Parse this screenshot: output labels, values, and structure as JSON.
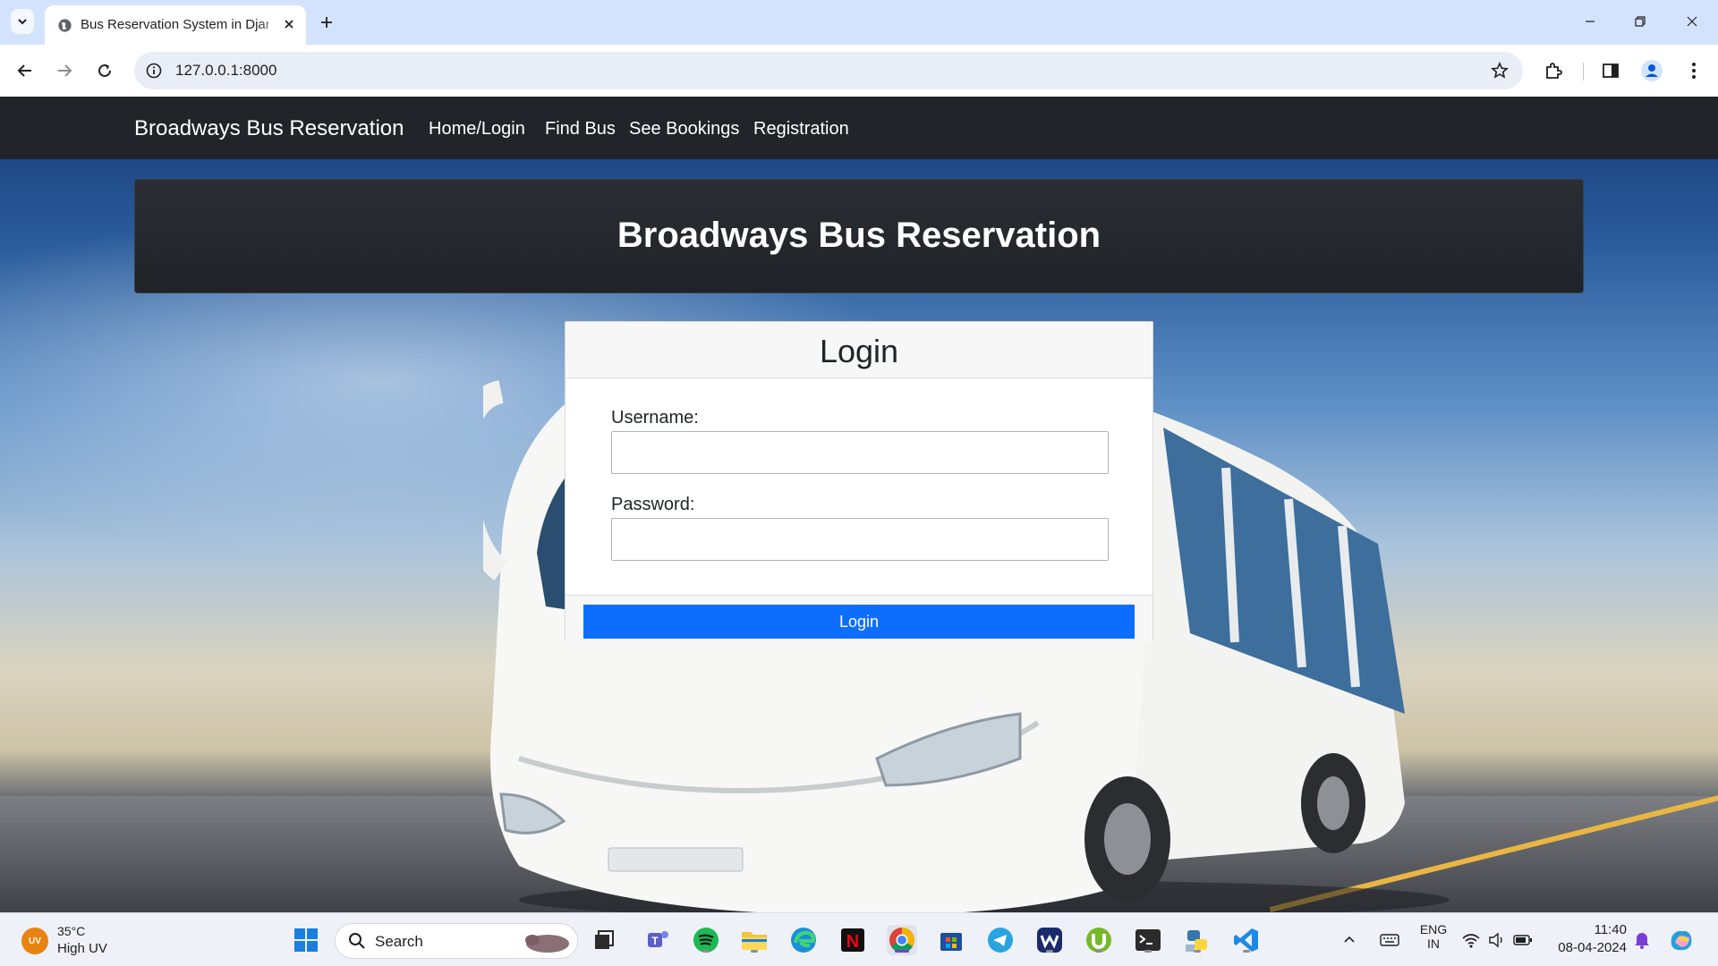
{
  "browser": {
    "tab_title": "Bus Reservation System in Django",
    "url": "127.0.0.1:8000"
  },
  "navbar": {
    "brand": "Broadways Bus Reservation",
    "links": [
      "Home/Login",
      "Find Bus",
      "See Bookings",
      "Registration"
    ]
  },
  "hero": {
    "title": "Broadways Bus Reservation"
  },
  "login": {
    "title": "Login",
    "username_label": "Username:",
    "username_value": "",
    "password_label": "Password:",
    "password_value": "",
    "button_label": "Login"
  },
  "taskbar": {
    "weather_temp": "35°C",
    "weather_desc": "High UV",
    "weather_badge": "UV",
    "search_placeholder": "Search",
    "lang_primary": "ENG",
    "lang_secondary": "IN",
    "time": "11:40",
    "date": "08-04-2024"
  },
  "colors": {
    "navbar_bg": "#212529",
    "primary_button": "#0d6efd",
    "tabstrip_bg": "#d3e3fd"
  }
}
